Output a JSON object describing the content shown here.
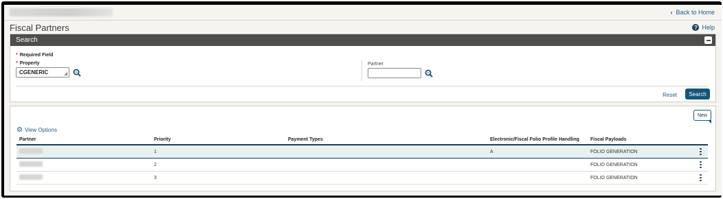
{
  "topbar": {
    "back_label": "Back to Home"
  },
  "page": {
    "title": "Fiscal Partners",
    "help_label": "Help"
  },
  "search": {
    "header": "Search",
    "required_note": "Required Field",
    "property_label": "Property",
    "property_value": "CGENERIC",
    "partner_label": "Partner",
    "partner_value": "",
    "reset_label": "Reset",
    "search_label": "Search"
  },
  "results": {
    "new_label": "New",
    "view_options_label": "View Options",
    "columns": [
      "Partner",
      "Priority",
      "Payment Types",
      "Electronic/Fiscal Folio Profile Handling",
      "Fiscal Payloads"
    ],
    "rows": [
      {
        "priority": "1",
        "payment_types": "",
        "handling": "A",
        "payloads": "FOLIO GENERATION"
      },
      {
        "priority": "2",
        "payment_types": "",
        "handling": "",
        "payloads": "FOLIO GENERATION"
      },
      {
        "priority": "3",
        "payment_types": "",
        "handling": "",
        "payloads": "FOLIO GENERATION"
      }
    ]
  },
  "icons": {
    "back": "chevron-left-icon",
    "help": "question-circle-icon",
    "collapse": "minus-square-icon",
    "lookup": "search-magnifier-icon",
    "view_options": "gear-icon",
    "row_actions": "vertical-ellipsis-icon"
  },
  "colors": {
    "accent": "#13577a",
    "link": "#2a5b7b",
    "header_bar": "#4d4d4b",
    "selected_row": "#e8f1f2",
    "required_star": "#c0392b"
  }
}
